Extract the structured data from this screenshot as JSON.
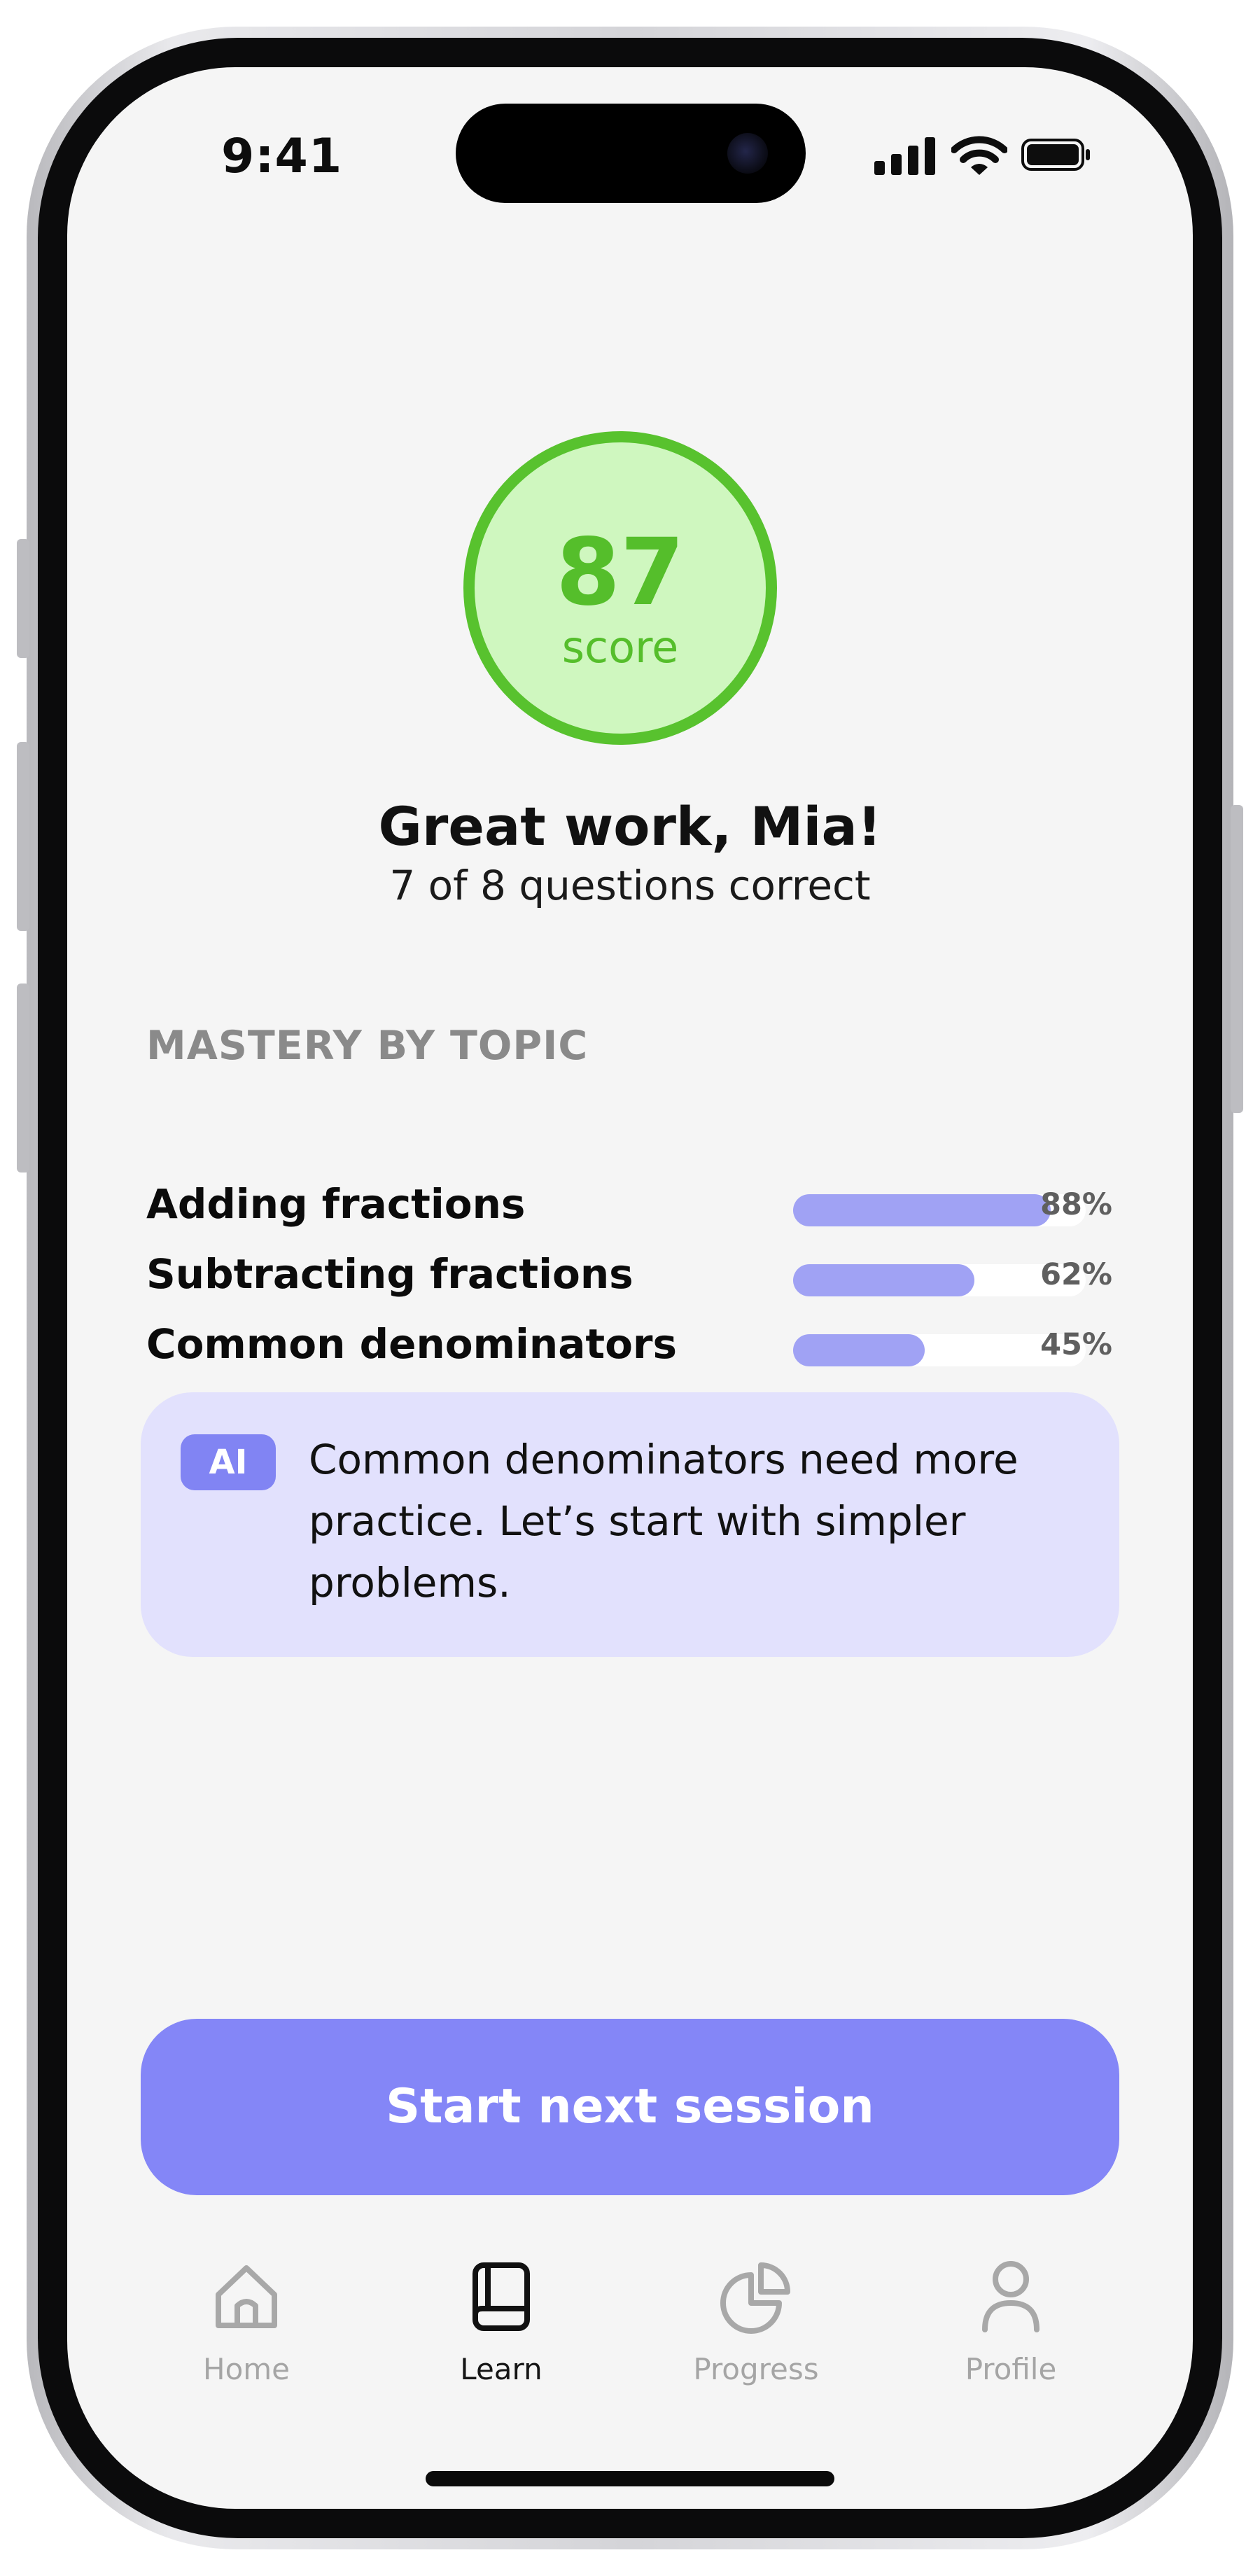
{
  "status_bar": {
    "time": "9:41"
  },
  "score": {
    "value": "87",
    "label": "score"
  },
  "headline": "Great work, Mia!",
  "subline": "7 of 8 questions correct",
  "mastery": {
    "title": "MASTERY BY TOPIC",
    "topics": [
      {
        "name": "Adding fractions",
        "percent_label": "88%",
        "level": 0.88
      },
      {
        "name": "Subtracting fractions",
        "percent_label": "62%",
        "level": 0.62
      },
      {
        "name": "Common denominators",
        "percent_label": "45%",
        "level": 0.45
      }
    ]
  },
  "ai_tip": {
    "badge": "AI",
    "text": "Common denominators need more practice. Let’s start with simpler problems."
  },
  "cta_label": "Start next session",
  "tabs": [
    {
      "label": "Home",
      "icon": "house-icon",
      "active": false
    },
    {
      "label": "Learn",
      "icon": "book-icon",
      "active": true
    },
    {
      "label": "Progress",
      "icon": "pie-chart-icon",
      "active": false
    },
    {
      "label": "Profile",
      "icon": "person-icon",
      "active": false
    }
  ],
  "colors": {
    "accent": "#8486F7",
    "score_green": "#58C22E",
    "score_fill": "#CFF7BF",
    "bar_fill": "#A0A2F4",
    "ai_card": "#E2E1FD"
  }
}
